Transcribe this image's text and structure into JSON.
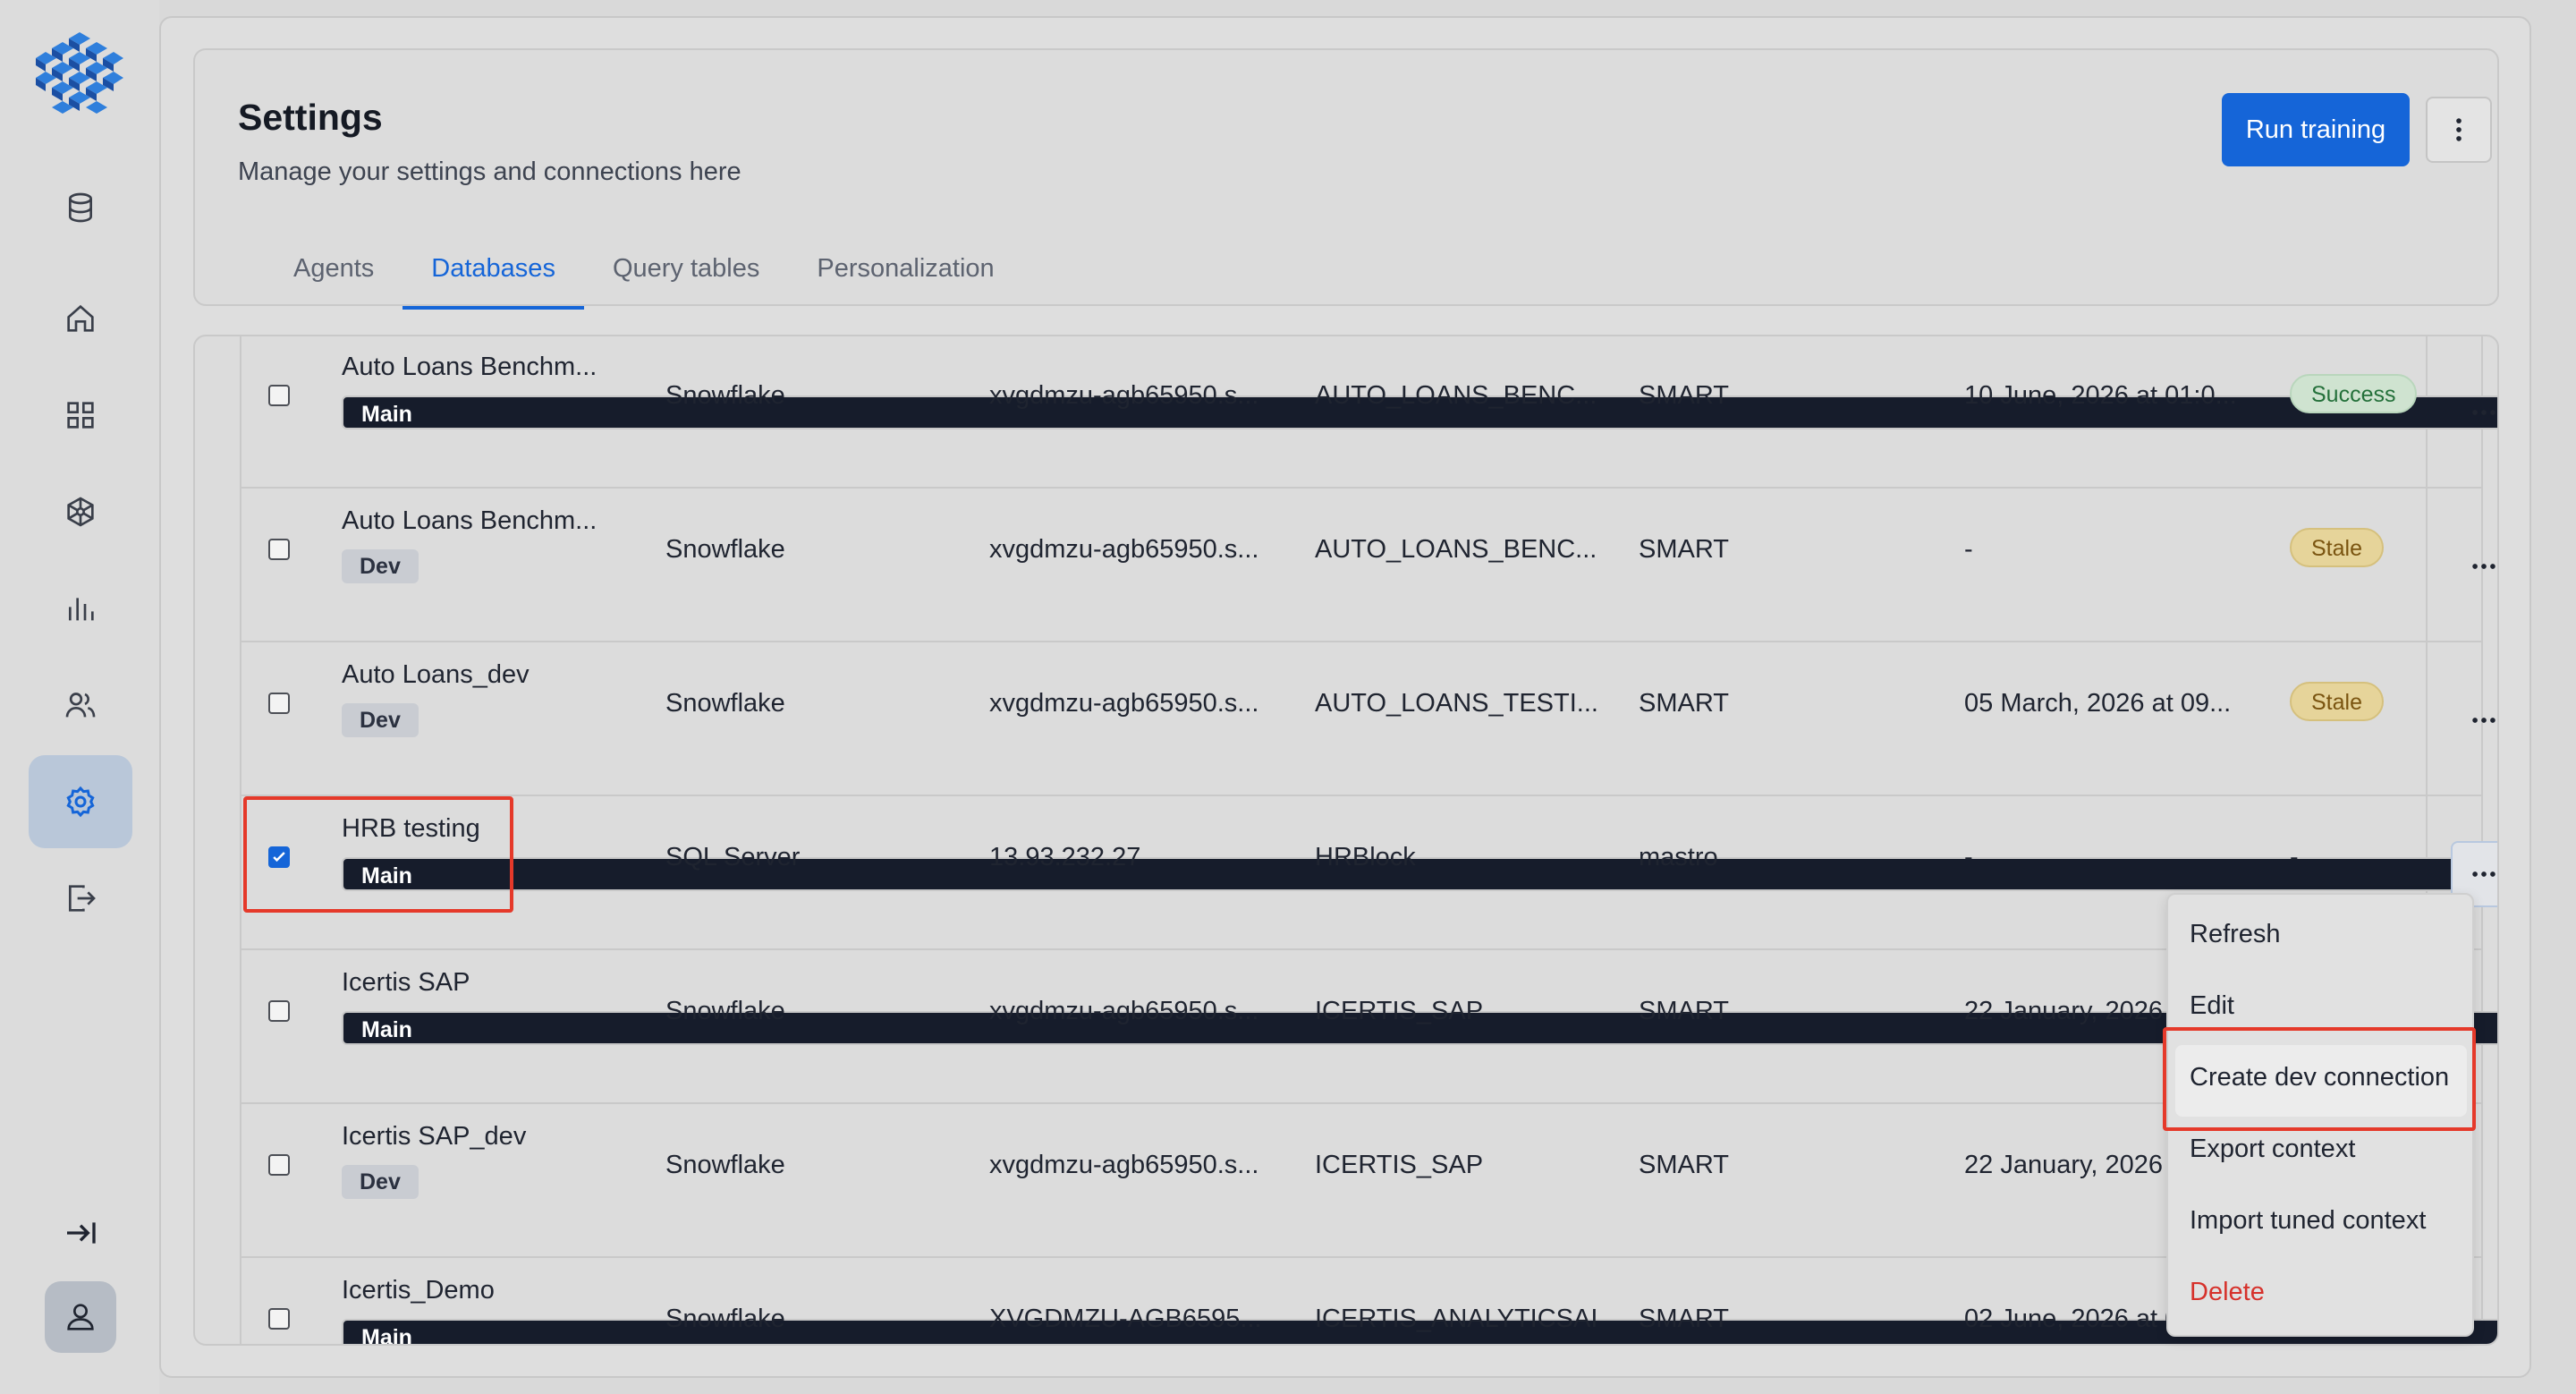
{
  "header": {
    "title": "Settings",
    "subtitle": "Manage your settings and connections here",
    "run_button": "Run training"
  },
  "tabs": [
    {
      "label": "Agents"
    },
    {
      "label": "Databases",
      "active": true
    },
    {
      "label": "Query tables"
    },
    {
      "label": "Personalization"
    }
  ],
  "sidebar": {
    "items": [
      {
        "icon": "database-icon"
      },
      {
        "icon": "home-icon"
      },
      {
        "icon": "dashboard-icon"
      },
      {
        "icon": "network-icon"
      },
      {
        "icon": "chart-icon"
      },
      {
        "icon": "users-icon"
      },
      {
        "icon": "settings-icon",
        "active": true
      },
      {
        "icon": "logout-icon"
      }
    ]
  },
  "rows": [
    {
      "name": "Auto Loans Benchm...",
      "tag": "Main",
      "type": "Snowflake",
      "host": "xvgdmzu-agb65950.s...",
      "database": "AUTO_LOANS_BENC...",
      "schema": "SMART",
      "updated": "10 June, 2026 at 01:0...",
      "status": "Success",
      "checked": false
    },
    {
      "name": "Auto Loans Benchm...",
      "tag": "Dev",
      "type": "Snowflake",
      "host": "xvgdmzu-agb65950.s...",
      "database": "AUTO_LOANS_BENC...",
      "schema": "SMART",
      "updated": "-",
      "status": "Stale",
      "checked": false
    },
    {
      "name": "Auto Loans_dev",
      "tag": "Dev",
      "type": "Snowflake",
      "host": "xvgdmzu-agb65950.s...",
      "database": "AUTO_LOANS_TESTI...",
      "schema": "SMART",
      "updated": "05 March, 2026 at 09...",
      "status": "Stale",
      "checked": false
    },
    {
      "name": "HRB testing",
      "tag": "Main",
      "type": "SQL Server",
      "host": "13.93.232.27",
      "database": "HRBlock",
      "schema": "mastro",
      "updated": "-",
      "status": "-",
      "checked": true
    },
    {
      "name": "Icertis SAP",
      "tag": "Main",
      "type": "Snowflake",
      "host": "xvgdmzu-agb65950.s...",
      "database": "ICERTIS_SAP",
      "schema": "SMART",
      "updated": "22 January, 2026 a",
      "status": "",
      "checked": false
    },
    {
      "name": "Icertis SAP_dev",
      "tag": "Dev",
      "type": "Snowflake",
      "host": "xvgdmzu-agb65950.s...",
      "database": "ICERTIS_SAP",
      "schema": "SMART",
      "updated": "22 January, 2026 a",
      "status": "",
      "checked": false
    },
    {
      "name": "Icertis_Demo",
      "tag": "Main",
      "type": "Snowflake",
      "host": "XVGDMZU-AGB6595...",
      "database": "ICERTIS_ANALYTICSAI",
      "schema": "SMART",
      "updated": "02 June, 2026 at 0",
      "status": "",
      "checked": false
    }
  ],
  "menu": {
    "items": [
      "Refresh",
      "Edit",
      "Create dev connection",
      "Export context",
      "Import tuned context",
      "Delete"
    ]
  },
  "colors": {
    "accent": "#1565d8",
    "highlight": "#e5392a",
    "danger": "#d6312b"
  }
}
